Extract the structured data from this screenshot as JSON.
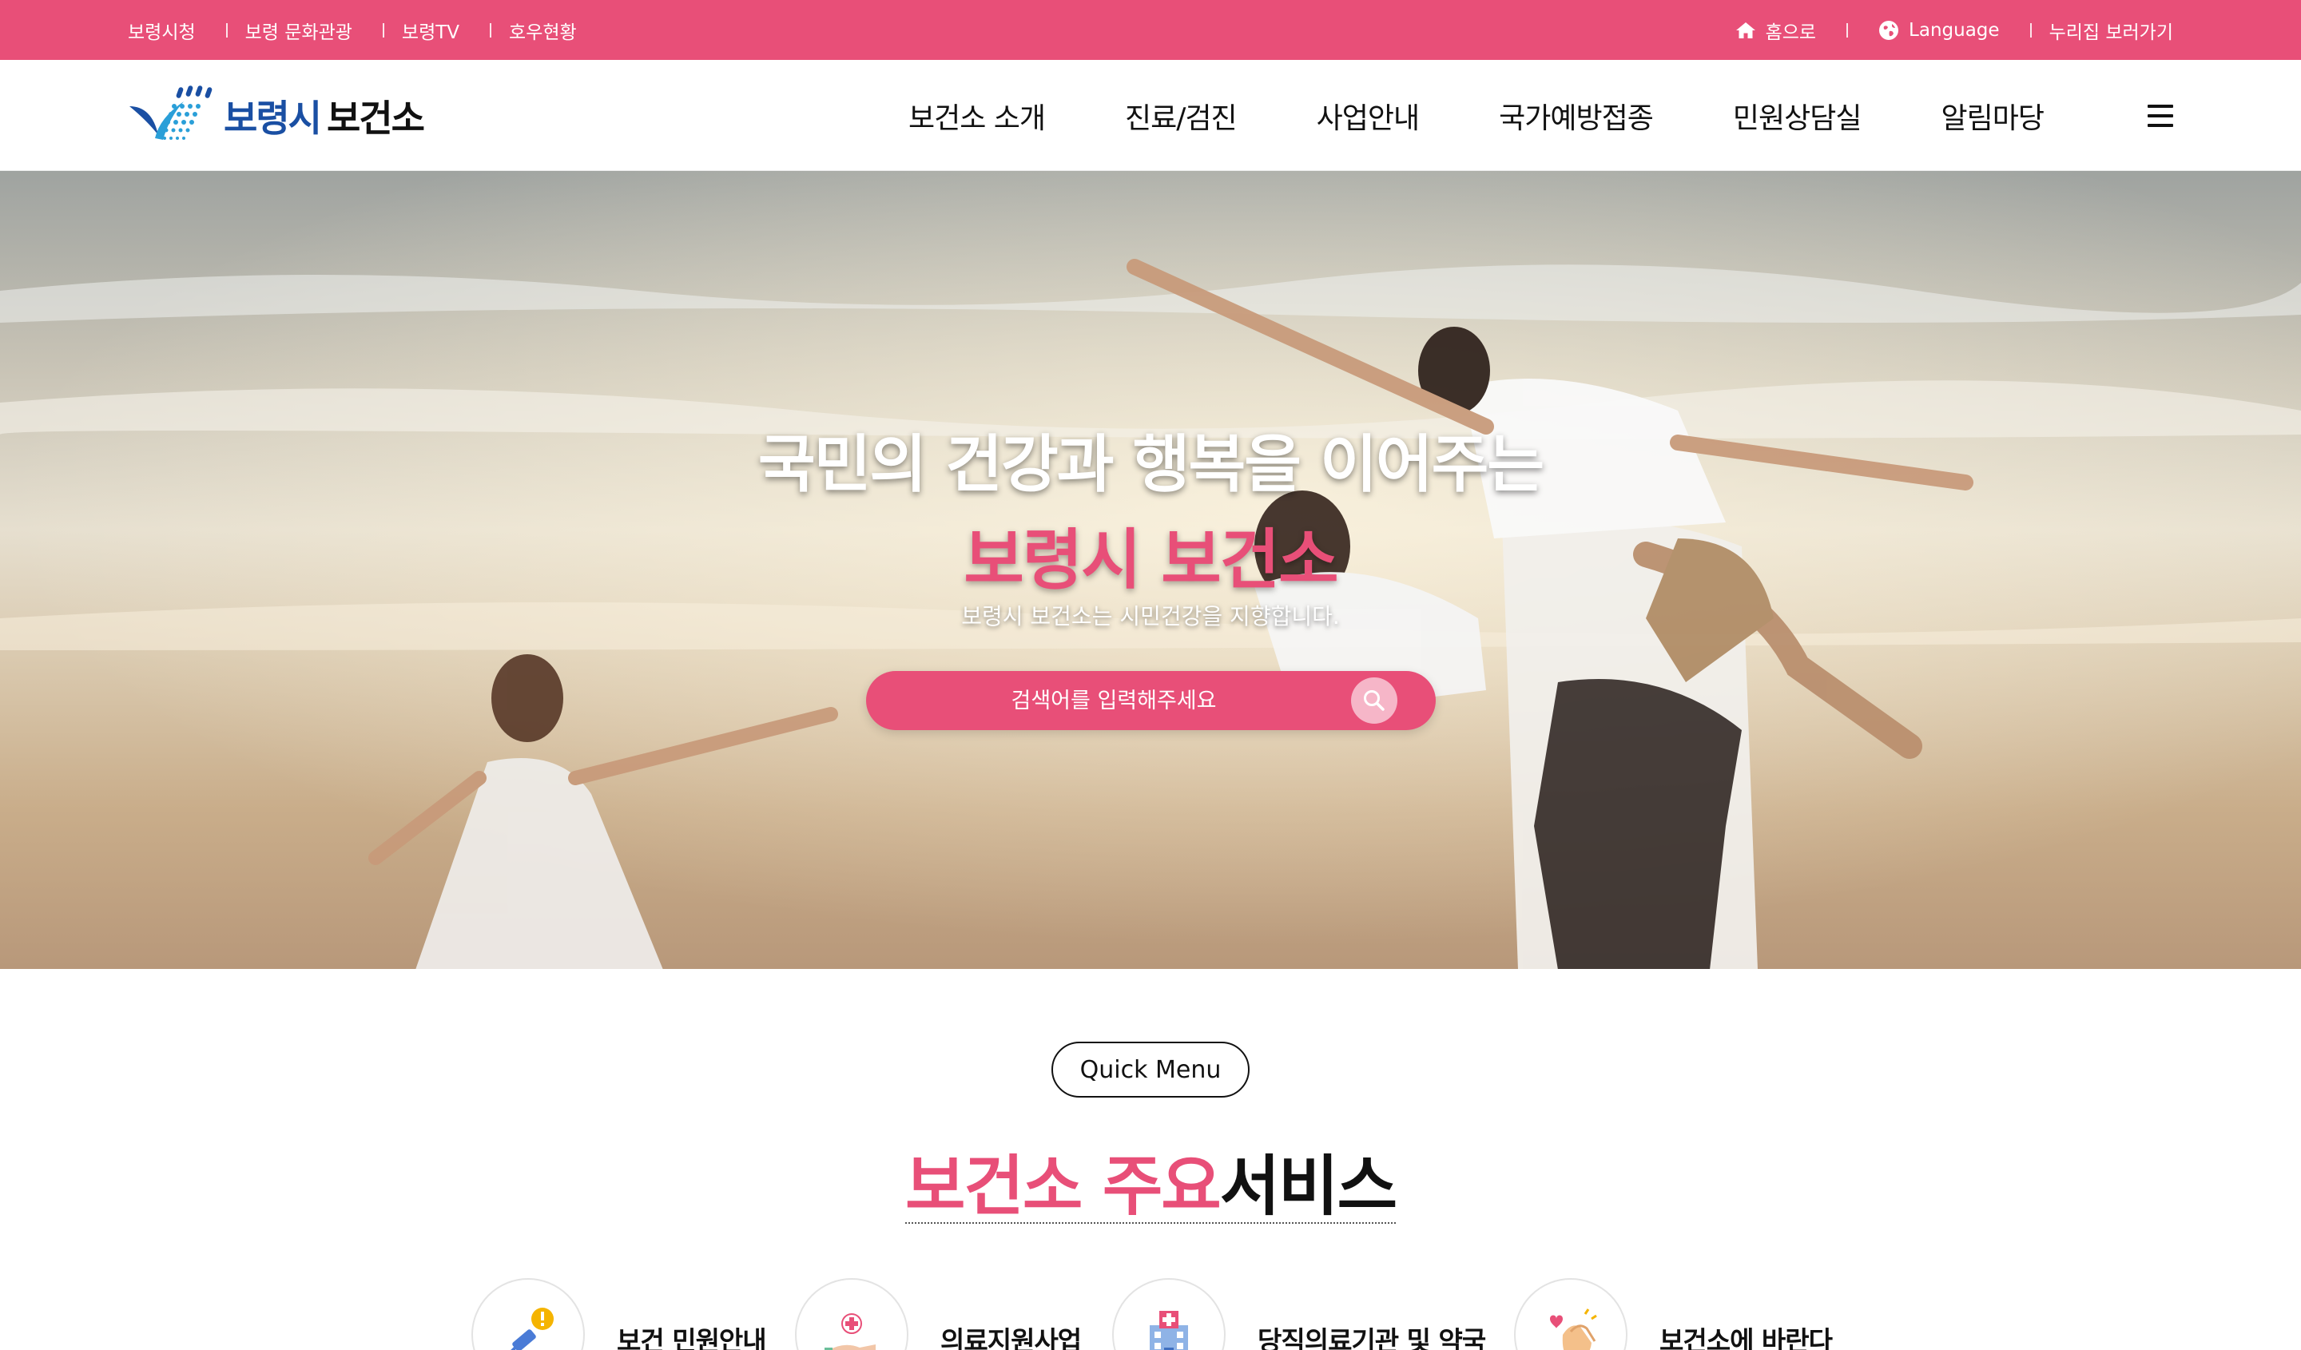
{
  "topbar": {
    "left_links": [
      "보령시청",
      "보령 문화관광",
      "보령TV",
      "호우현황"
    ],
    "home_label": "홈으로",
    "language_label": "Language",
    "nuri_label": "누리집 보러가기"
  },
  "header": {
    "logo": {
      "text_a": "보령시",
      "text_b": "보건소"
    },
    "nav": [
      "보건소 소개",
      "진료/검진",
      "사업안내",
      "국가예방접종",
      "민원상담실",
      "알림마당"
    ]
  },
  "hero": {
    "title": "국민의 건강과 행복을 이어주는",
    "subtitle": "보령시 보건소",
    "description": "보령시 보건소는 시민건강을 지향합니다.",
    "search_placeholder": "검색어를 입력해주세요"
  },
  "quick_menu": {
    "pill_label": "Quick Menu",
    "title_pink": "보건소 주요",
    "title_dark": "서비스",
    "items": [
      {
        "label": "보건 민원안내",
        "icon": "syringe-warning-icon"
      },
      {
        "label": "의료지원사업",
        "icon": "medical-hand-icon"
      },
      {
        "label": "당직의료기관 및 약국",
        "icon": "hospital-building-icon"
      },
      {
        "label": "보건소에 바란다",
        "icon": "clapping-hands-icon"
      }
    ]
  },
  "colors": {
    "brand_pink": "#e84f78",
    "logo_blue": "#1a4fa3",
    "text_dark": "#111111"
  }
}
